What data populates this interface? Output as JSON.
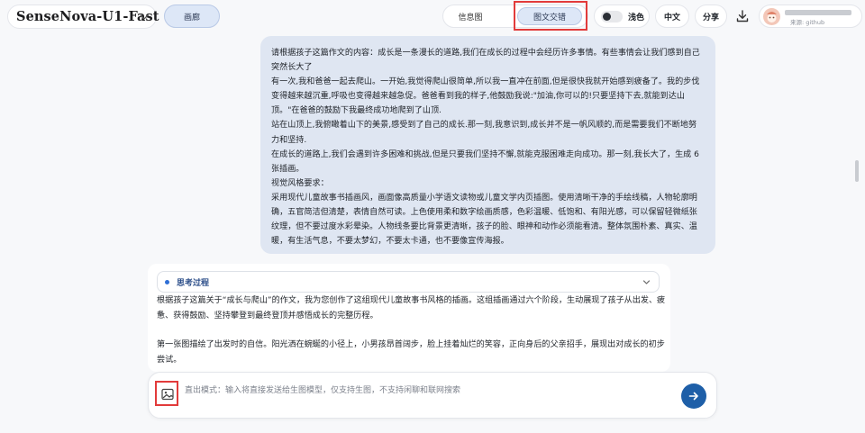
{
  "header": {
    "model_name": "SenseNova-U1-Fast",
    "gallery_label": "画廊",
    "mode_tabs": [
      {
        "label": "信息图"
      },
      {
        "label": "图文交错"
      }
    ],
    "theme_label": "浅色",
    "lang_label": "中文",
    "share_label": "分享",
    "user_source": "来源: github"
  },
  "conversation": {
    "user_message": [
      "请根据孩子这篇作文的内容：成长是一条漫长的道路,我们在成长的过程中会经历许多事情。有些事情会让我们感到自己突然长大了",
      "有一次,我和爸爸一起去爬山。一开始,我觉得爬山很简单,所以我一直冲在前面,但是很快我就开始感到疲备了。我的步伐变得越来越沉重,呼吸也变得越来越急促。爸爸看到我的样子,他鼓励我说:\"加油,你可以的!只要坚持下去,就能到达山顶。\"在爸爸的鼓励下我最终成功地爬到了山顶.",
      "站在山顶上,我俯瞰着山下的美景,感受到了自己的成长.那一刻,我意识到,成长并不是一帆风顺的,而是需要我们不断地努力和坚持.",
      "在成长的道路上,我们会遇到许多困难和挑战,但是只要我们坚持不懈,就能克服困难走向成功。那一刻,我长大了，生成 6 张插画。",
      "视觉风格要求：",
      "采用现代儿童故事书插画风，画面像高质量小学语文读物或儿童文学内页插图。使用清晰干净的手绘线稿，人物轮廓明确，五官简洁但清楚，表情自然可读。上色使用柔和数字绘画质感，色彩温暖、低饱和、有阳光感，可以保留轻微纸张纹理，但不要过度水彩晕染。人物线条要比背景更清晰，孩子的脸、眼神和动作必须能看清。整体氛围朴素、真实、温暖，有生活气息，不要太梦幻，不要太卡通，也不要像宣传海报。"
    ],
    "thinking_label": "思考过程",
    "answer_paragraphs": [
      "根据孩子这篇关于“成长与爬山”的作文，我为您创作了这组现代儿童故事书风格的插画。这组插画通过六个阶段，生动展现了孩子从出发、疲惫、获得鼓励、坚持攀登到最终登顶并感悟成长的完整历程。",
      "第一张图描绘了出发时的自信。阳光洒在蜿蜒的小径上，小男孩昂首阔步，脸上挂着灿烂的笑容，正向身后的父亲招手，展现出对成长的初步尝试。"
    ]
  },
  "composer": {
    "placeholder": "直出模式：输入将直接发送给生图模型，仅支持生图，不支持闲聊和联网搜索",
    "value": ""
  },
  "colors": {
    "accent": "#1e5fa8",
    "highlight_box": "#e23b3b",
    "user_bubble": "#dfe6f2"
  },
  "icons": [
    "chevron-down-icon",
    "download-icon",
    "image-icon",
    "arrow-right-icon"
  ]
}
